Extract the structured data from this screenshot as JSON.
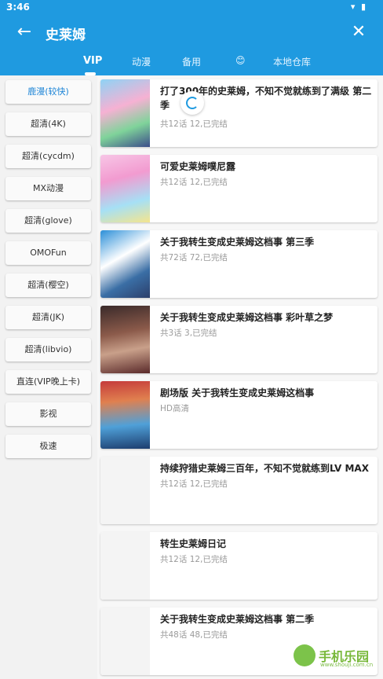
{
  "status": {
    "time": "3:46",
    "icons": "wifi-icon battery-icon"
  },
  "header": {
    "back_icon": "←",
    "title": "史莱姆",
    "close_icon": "✕"
  },
  "tabs": [
    {
      "label": "VIP",
      "active": true
    },
    {
      "label": "动漫",
      "active": false
    },
    {
      "label": "备用",
      "active": false
    },
    {
      "label": "😊",
      "active": false
    },
    {
      "label": "本地仓库",
      "active": false
    }
  ],
  "sources": [
    {
      "label": "鹿漫(较快)",
      "active": true
    },
    {
      "label": "超清(4K)"
    },
    {
      "label": "超清(cycdm)"
    },
    {
      "label": "MX动漫"
    },
    {
      "label": "超清(glove)"
    },
    {
      "label": "OMOFun"
    },
    {
      "label": "超清(樱空)"
    },
    {
      "label": "超清(JK)"
    },
    {
      "label": "超清(libvio)"
    },
    {
      "label": "直连(VIP晚上卡)"
    },
    {
      "label": "影视"
    },
    {
      "label": "极速"
    }
  ],
  "results": [
    {
      "title": "打了300年的史莱姆，不知不觉就练到了满级 第二季",
      "sub": "共12话 12,已完结"
    },
    {
      "title": "可爱史莱姆噗尼露",
      "sub": "共12话 12,已完结"
    },
    {
      "title": "关于我转生变成史莱姆这档事 第三季",
      "sub": "共72话 72,已完结"
    },
    {
      "title": "关于我转生变成史莱姆这档事 彩叶草之梦",
      "sub": "共3话 3,已完结"
    },
    {
      "title": "剧场版 关于我转生变成史莱姆这档事",
      "sub": "HD高清"
    },
    {
      "title": "持续狩猎史莱姆三百年，不知不觉就练到LV MAX",
      "sub": "共12话 12,已完结"
    },
    {
      "title": "转生史莱姆日记",
      "sub": "共12话 12,已完结"
    },
    {
      "title": "关于我转生变成史莱姆这档事 第二季",
      "sub": "共48话 48,已完结"
    }
  ],
  "watermark": {
    "text": "手机乐园",
    "site": "www.shouji.com.cn"
  },
  "colors": {
    "primary": "#1f9ae0",
    "active_source": "#1c84d6"
  }
}
